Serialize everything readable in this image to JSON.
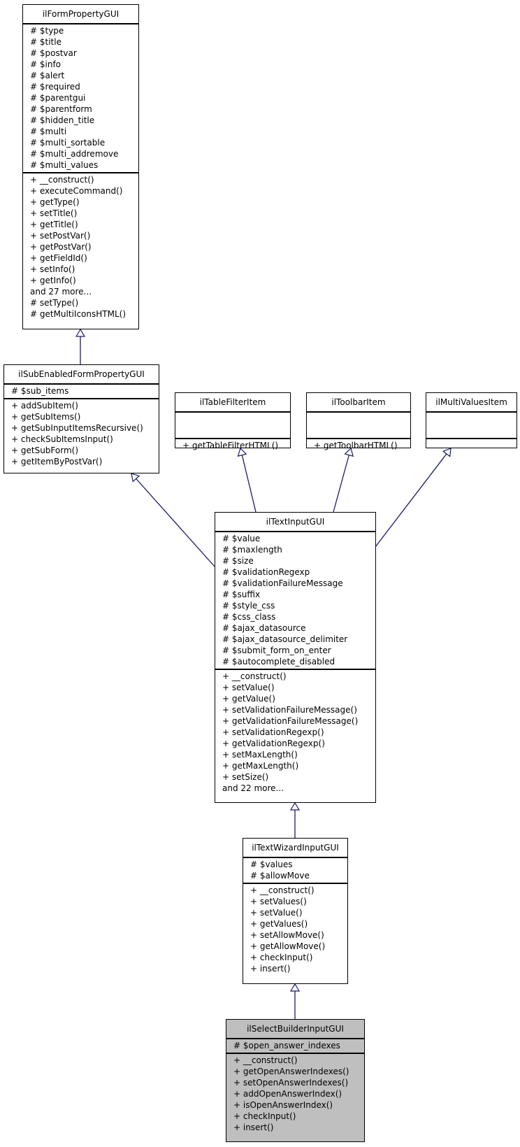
{
  "diagram": {
    "type": "uml-inheritance",
    "edge_color": "#191970",
    "highlight_color": "#bfbfbf",
    "classes": {
      "ilFormPropertyGUI": {
        "name": "ilFormPropertyGUI",
        "attributes": [
          "# $type",
          "# $title",
          "# $postvar",
          "# $info",
          "# $alert",
          "# $required",
          "# $parentgui",
          "# $parentform",
          "# $hidden_title",
          "# $multi",
          "# $multi_sortable",
          "# $multi_addremove",
          "# $multi_values"
        ],
        "methods": [
          "+ __construct()",
          "+ executeCommand()",
          "+ getType()",
          "+ setTitle()",
          "+ getTitle()",
          "+ setPostVar()",
          "+ getPostVar()",
          "+ getFieldId()",
          "+ setInfo()",
          "+ getInfo()",
          "and 27 more...",
          "# setType()",
          "# getMultiIconsHTML()"
        ]
      },
      "ilSubEnabledFormPropertyGUI": {
        "name": "ilSubEnabledFormPropertyGUI",
        "attributes": [
          "# $sub_items"
        ],
        "methods": [
          "+ addSubItem()",
          "+ getSubItems()",
          "+ getSubInputItemsRecursive()",
          "+ checkSubItemsInput()",
          "+ getSubForm()",
          "+ getItemByPostVar()"
        ]
      },
      "ilTableFilterItem": {
        "name": "ilTableFilterItem",
        "attributes": [],
        "methods": [
          "+ getTableFilterHTML()"
        ]
      },
      "ilToolbarItem": {
        "name": "ilToolbarItem",
        "attributes": [],
        "methods": [
          "+ getToolbarHTML()"
        ]
      },
      "ilMultiValuesItem": {
        "name": "ilMultiValuesItem",
        "attributes": [],
        "methods": []
      },
      "ilTextInputGUI": {
        "name": "ilTextInputGUI",
        "attributes": [
          "# $value",
          "# $maxlength",
          "# $size",
          "# $validationRegexp",
          "# $validationFailureMessage",
          "# $suffix",
          "# $style_css",
          "# $css_class",
          "# $ajax_datasource",
          "# $ajax_datasource_delimiter",
          "# $submit_form_on_enter",
          "# $autocomplete_disabled"
        ],
        "methods": [
          "+ __construct()",
          "+ setValue()",
          "+ getValue()",
          "+ setValidationFailureMessage()",
          "+ getValidationFailureMessage()",
          "+ setValidationRegexp()",
          "+ getValidationRegexp()",
          "+ setMaxLength()",
          "+ getMaxLength()",
          "+ setSize()",
          "and 22 more..."
        ]
      },
      "ilTextWizardInputGUI": {
        "name": "ilTextWizardInputGUI",
        "attributes": [
          "# $values",
          "# $allowMove"
        ],
        "methods": [
          "+ __construct()",
          "+ setValues()",
          "+ setValue()",
          "+ getValues()",
          "+ setAllowMove()",
          "+ getAllowMove()",
          "+ checkInput()",
          "+ insert()"
        ]
      },
      "ilSelectBuilderInputGUI": {
        "name": "ilSelectBuilderInputGUI",
        "highlighted": true,
        "attributes": [
          "# $open_answer_indexes"
        ],
        "methods": [
          "+ __construct()",
          "+ getOpenAnswerIndexes()",
          "+ setOpenAnswerIndexes()",
          "+ addOpenAnswerIndex()",
          "+ isOpenAnswerIndex()",
          "+ checkInput()",
          "+ insert()"
        ]
      }
    },
    "inheritance": [
      {
        "child": "ilSubEnabledFormPropertyGUI",
        "parent": "ilFormPropertyGUI"
      },
      {
        "child": "ilTextInputGUI",
        "parent": "ilSubEnabledFormPropertyGUI"
      },
      {
        "child": "ilTextInputGUI",
        "parent": "ilTableFilterItem"
      },
      {
        "child": "ilTextInputGUI",
        "parent": "ilToolbarItem"
      },
      {
        "child": "ilTextInputGUI",
        "parent": "ilMultiValuesItem"
      },
      {
        "child": "ilTextWizardInputGUI",
        "parent": "ilTextInputGUI"
      },
      {
        "child": "ilSelectBuilderInputGUI",
        "parent": "ilTextWizardInputGUI"
      }
    ]
  }
}
